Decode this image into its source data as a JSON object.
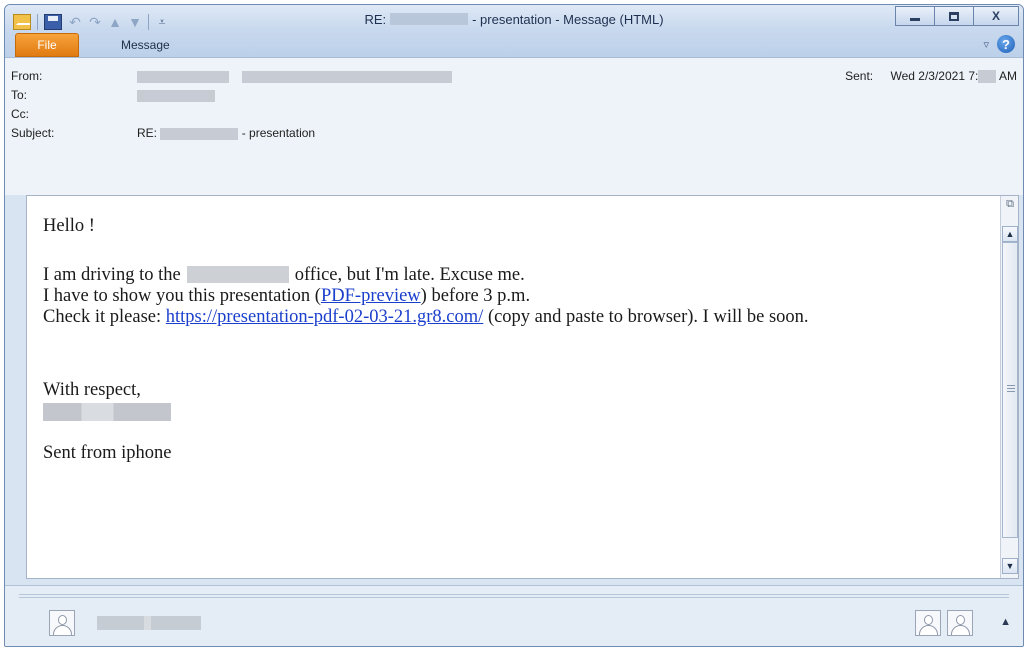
{
  "window": {
    "title_prefix": "RE:",
    "title_suffix": "- presentation  -  Message (HTML)"
  },
  "ribbon": {
    "tabs": [
      {
        "label": "File",
        "active": true
      },
      {
        "label": "Message",
        "active": false
      }
    ],
    "help_label": "?",
    "expand_glyph": "▿"
  },
  "header": {
    "from_label": "From:",
    "to_label": "To:",
    "cc_label": "Cc:",
    "subject_label": "Subject:",
    "subject_prefix": "RE:",
    "subject_suffix": "- presentation",
    "sent_label": "Sent:",
    "sent_value_prefix": "Wed 2/3/2021 7:",
    "sent_value_suffix": "AM"
  },
  "message": {
    "greeting": "Hello !",
    "line1_a": "I am driving to the",
    "line1_b": "office, but I'm late. Excuse me.",
    "line2_a": "I have to show you this presentation (",
    "line2_link": "PDF-preview",
    "line2_b": ") before 3 p.m.",
    "line3_a": "Check it please: ",
    "line3_link": "https://presentation-pdf-02-03-21.gr8.com/",
    "line3_b": " (copy and paste to browser). I will be soon.",
    "closing": "With respect,",
    "footer": "Sent from iphone"
  },
  "colors": {
    "accent_file_tab": "#e88a1e",
    "link": "#1a3fcc",
    "window_frame": "#c9d9ee"
  },
  "icons": [
    "envelope-icon",
    "save-icon",
    "undo-icon",
    "redo-icon",
    "up-icon",
    "down-icon",
    "customize-qat-icon",
    "minimize-icon",
    "maximize-icon",
    "close-icon",
    "help-icon",
    "contact-avatar-icon"
  ]
}
